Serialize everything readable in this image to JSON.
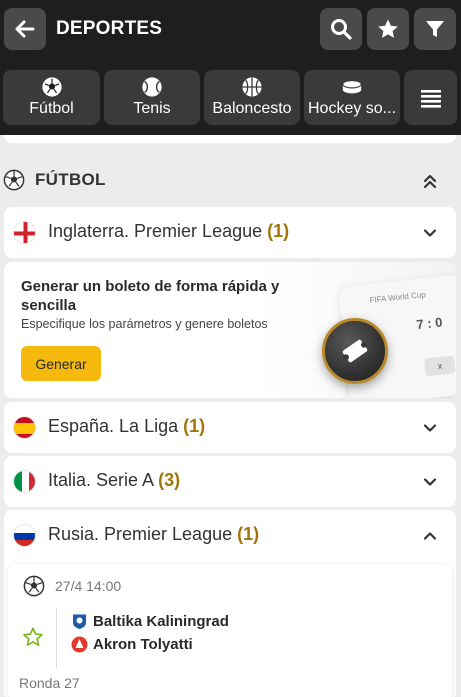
{
  "header": {
    "title": "DEPORTES",
    "icons": {
      "back": "arrow-left-icon",
      "search": "search-icon",
      "favorites": "star-icon",
      "filter": "filter-icon"
    }
  },
  "sport_tabs": [
    {
      "label": "Fútbol",
      "icon": "soccer-ball-icon"
    },
    {
      "label": "Tenis",
      "icon": "tennis-ball-icon"
    },
    {
      "label": "Baloncesto",
      "icon": "basketball-icon"
    },
    {
      "label": "Hockey so...",
      "icon": "hockey-puck-icon"
    }
  ],
  "section": {
    "title": "FÚTBOL",
    "icon": "soccer-ball-icon"
  },
  "leagues": [
    {
      "name": "Inglaterra. Premier League",
      "count": "(1)",
      "flag": "england"
    },
    {
      "name": "España. La Liga",
      "count": "(1)",
      "flag": "spain"
    },
    {
      "name": "Italia. Serie A",
      "count": "(3)",
      "flag": "italy"
    },
    {
      "name": "Rusia. Premier League",
      "count": "(1)",
      "flag": "russia"
    }
  ],
  "promo": {
    "title": "Generar un boleto de forma rápida y sencilla",
    "subtitle": "Especifique los parámetros y genere boletos",
    "button_label": "Generar",
    "card_label": "FIFA World Cup",
    "card_score": "7 : 0",
    "card_x": "x"
  },
  "match": {
    "datetime": "27/4 14:00",
    "team1": "Baltika Kaliningrad",
    "team2": "Akron Tolyatti",
    "round": "Ronda 27"
  },
  "colors": {
    "header_bg": "#1e1e1e",
    "accent": "#f5b90e",
    "count_color": "#a0760b"
  }
}
